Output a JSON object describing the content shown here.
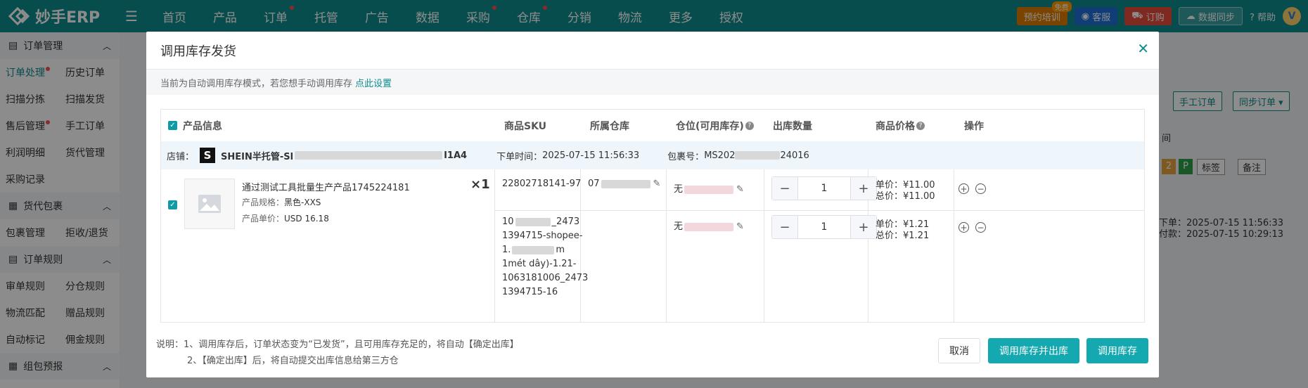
{
  "topbar": {
    "logo_text": "妙手ERP",
    "nav": [
      {
        "label": "首页",
        "dot": false
      },
      {
        "label": "产品",
        "dot": false
      },
      {
        "label": "订单",
        "dot": true
      },
      {
        "label": "托管",
        "dot": false
      },
      {
        "label": "广告",
        "dot": false
      },
      {
        "label": "数据",
        "dot": false
      },
      {
        "label": "采购",
        "dot": true
      },
      {
        "label": "仓库",
        "dot": true
      },
      {
        "label": "分销",
        "dot": false
      },
      {
        "label": "物流",
        "dot": false
      },
      {
        "label": "更多",
        "dot": false
      },
      {
        "label": "授权",
        "dot": false
      }
    ],
    "train_label": "预约培训",
    "train_badge": "免费",
    "service_label": "客服",
    "order_label": "订购",
    "sync_label": "数据同步",
    "help_label": "帮助",
    "avatar_letter": "V"
  },
  "sidebar": {
    "groups": [
      {
        "title": "订单管理",
        "items": [
          [
            "订单处理",
            "历史订单"
          ],
          [
            "扫描分拣",
            "扫描发货"
          ],
          [
            "售后管理",
            "手工订单"
          ],
          [
            "利润明细",
            "货代管理"
          ],
          [
            "采购记录",
            ""
          ]
        ]
      },
      {
        "title": "货代包裹",
        "items": [
          [
            "包裹管理",
            "拒收/退货"
          ]
        ]
      },
      {
        "title": "订单规则",
        "items": [
          [
            "审单规则",
            "分仓规则"
          ],
          [
            "物流匹配",
            "赠品规则"
          ],
          [
            "自动标记",
            "佣金规则"
          ]
        ]
      },
      {
        "title": "组包预报",
        "items": []
      }
    ]
  },
  "background": {
    "manual_order": "手工订单",
    "sync_order": "同步订单 ▾",
    "tag_label": "标签",
    "note_label": "备注",
    "col_time": "间",
    "time1": "下单：2025-07-15 11:56:33",
    "time2": "付款：2025-07-15 10:29:13",
    "badge_2": "2",
    "badge_p": "P"
  },
  "modal": {
    "title": "调用库存发货",
    "tip": "当前为自动调用库存模式，若您想手动调用库存",
    "tip_link": "点此设置",
    "columns": {
      "product": "产品信息",
      "sku": "商品SKU",
      "warehouse": "所属仓库",
      "location": "仓位(可用库存)",
      "qty": "出库数量",
      "price": "商品价格",
      "action": "操作"
    },
    "store_label": "店铺：",
    "store_name": "SHEIN半托管-Sl",
    "store_suffix": "I1A4",
    "order_time_label": "下单时间：",
    "order_time": "2025-07-15 11:56:33",
    "package_label": "包裹号：",
    "package_prefix": "MS202",
    "package_suffix": "24016",
    "product": {
      "name": "通过测试工具批量生产产品1745224181",
      "spec_label": "产品规格：",
      "spec": "黑色-XXS",
      "unit_label": "产品单价：",
      "unit_price": "USD 16.18",
      "multiplier": "×1"
    },
    "rows": [
      {
        "sku": [
          "22802718141-97"
        ],
        "warehouse": "07",
        "location": "无",
        "qty": "1",
        "unit_label": "单价：",
        "unit_price": "¥11.00",
        "total_label": "总价：",
        "total_price": "¥11.00"
      },
      {
        "sku": [
          "10",
          "1394715-shopee-",
          "1.",
          "1mét dây)-1.21-",
          "1063181006_2473",
          "1394715-16"
        ],
        "sku_tail": "_2473",
        "sku_tail2": "m",
        "warehouse": "",
        "location": "无",
        "qty": "1",
        "unit_label": "单价：",
        "unit_price": "¥1.21",
        "total_label": "总价：",
        "total_price": "¥1.21"
      }
    ],
    "note_1": "说明：1、调用库存后，订单状态变为“已发货”，且可用库存充足的，将自动【确定出库】",
    "note_2": "2、【确定出库】后，将自动提交出库信息给第三方仓",
    "btn_cancel": "取消",
    "btn_call_out": "调用库存并出库",
    "btn_call": "调用库存"
  },
  "colors": {
    "brand": "#0f8c8c",
    "primary_button": "#14a8b0",
    "alert": "#ff4d4f"
  }
}
